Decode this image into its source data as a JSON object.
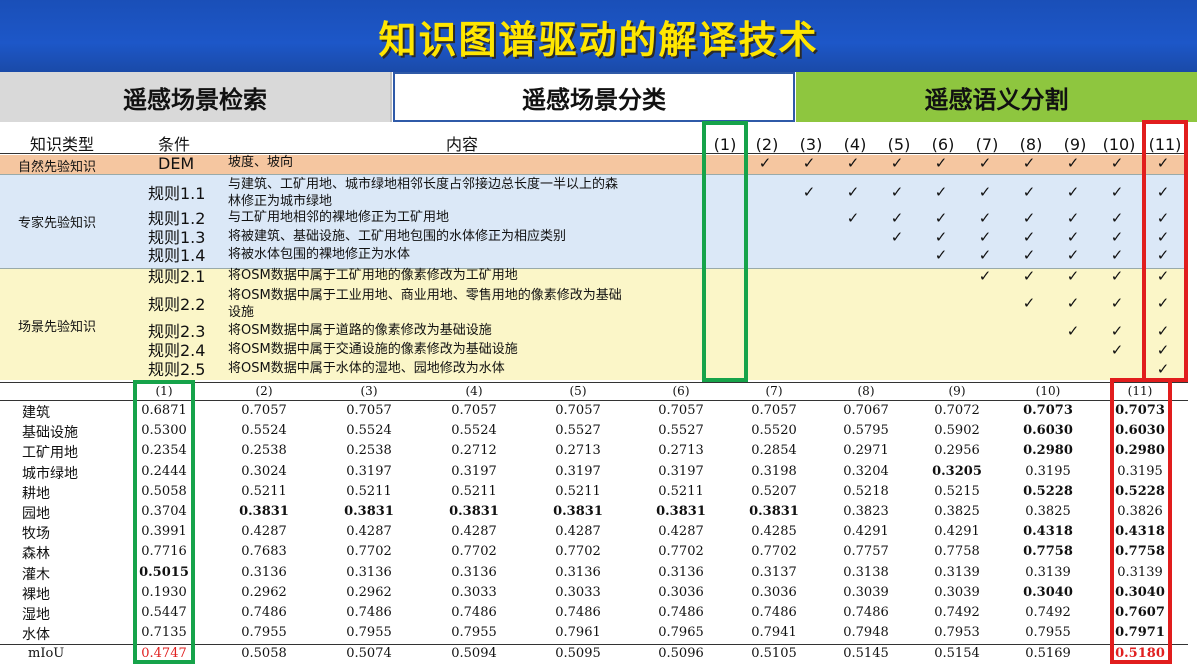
{
  "banner": {
    "title": "知识图谱驱动的解译技术"
  },
  "tabs": [
    {
      "label": "遥感场景检索"
    },
    {
      "label": "遥感场景分类"
    },
    {
      "label": "遥感语义分割"
    }
  ],
  "rules": {
    "headers": {
      "type": "知识类型",
      "cond": "条件",
      "content": "内容"
    },
    "method_cols": [
      "(1)",
      "(2)",
      "(3)",
      "(4)",
      "(5)",
      "(6)",
      "(7)",
      "(8)",
      "(9)",
      "(10)",
      "(11)"
    ],
    "check_glyph": "✓",
    "categories": {
      "natural": "自然先验知识",
      "expert": "专家先验知识",
      "scene": "场景先验知识"
    },
    "rows": [
      {
        "cond": "DEM",
        "content": [
          "坡度、坡向"
        ],
        "checks": [
          false,
          true,
          true,
          true,
          true,
          true,
          true,
          true,
          true,
          true,
          true
        ]
      },
      {
        "cond": "规则1.1",
        "content": [
          "与建筑、工矿用地、城市绿地相邻长度占邻接边总长度一半以上的森",
          "林修正为城市绿地"
        ],
        "checks": [
          false,
          false,
          true,
          true,
          true,
          true,
          true,
          true,
          true,
          true,
          true
        ]
      },
      {
        "cond": "规则1.2",
        "content": [
          "与工矿用地相邻的裸地修正为工矿用地"
        ],
        "checks": [
          false,
          false,
          false,
          true,
          true,
          true,
          true,
          true,
          true,
          true,
          true
        ]
      },
      {
        "cond": "规则1.3",
        "content": [
          "将被建筑、基础设施、工矿用地包围的水体修正为相应类别"
        ],
        "checks": [
          false,
          false,
          false,
          false,
          true,
          true,
          true,
          true,
          true,
          true,
          true
        ]
      },
      {
        "cond": "规则1.4",
        "content": [
          "将被水体包围的裸地修正为水体"
        ],
        "checks": [
          false,
          false,
          false,
          false,
          false,
          true,
          true,
          true,
          true,
          true,
          true
        ]
      },
      {
        "cond": "规则2.1",
        "content": [
          "将OSM数据中属于工矿用地的像素修改为工矿用地"
        ],
        "checks": [
          false,
          false,
          false,
          false,
          false,
          false,
          true,
          true,
          true,
          true,
          true
        ]
      },
      {
        "cond": "规则2.2",
        "content": [
          "将OSM数据中属于工业用地、商业用地、零售用地的像素修改为基础",
          "设施"
        ],
        "checks": [
          false,
          false,
          false,
          false,
          false,
          false,
          false,
          true,
          true,
          true,
          true
        ]
      },
      {
        "cond": "规则2.3",
        "content": [
          "将OSM数据中属于道路的像素修改为基础设施"
        ],
        "checks": [
          false,
          false,
          false,
          false,
          false,
          false,
          false,
          false,
          true,
          true,
          true
        ]
      },
      {
        "cond": "规则2.4",
        "content": [
          "将OSM数据中属于交通设施的像素修改为基础设施"
        ],
        "checks": [
          false,
          false,
          false,
          false,
          false,
          false,
          false,
          false,
          false,
          true,
          true
        ]
      },
      {
        "cond": "规则2.5",
        "content": [
          "将OSM数据中属于水体的湿地、园地修改为水体"
        ],
        "checks": [
          false,
          false,
          false,
          false,
          false,
          false,
          false,
          false,
          false,
          false,
          true
        ]
      }
    ]
  },
  "results": {
    "columns": [
      "(1)",
      "(2)",
      "(3)",
      "(4)",
      "(5)",
      "(6)",
      "(7)",
      "(8)",
      "(9)",
      "(10)",
      "(11)"
    ],
    "rows": [
      {
        "label": "建筑",
        "values": [
          "0.6871",
          "0.7057",
          "0.7057",
          "0.7057",
          "0.7057",
          "0.7057",
          "0.7057",
          "0.7067",
          "0.7072",
          "0.7073",
          "0.7073"
        ],
        "bold": [
          9,
          10
        ]
      },
      {
        "label": "基础设施",
        "values": [
          "0.5300",
          "0.5524",
          "0.5524",
          "0.5524",
          "0.5527",
          "0.5527",
          "0.5520",
          "0.5795",
          "0.5902",
          "0.6030",
          "0.6030"
        ],
        "bold": [
          9,
          10
        ]
      },
      {
        "label": "工矿用地",
        "values": [
          "0.2354",
          "0.2538",
          "0.2538",
          "0.2712",
          "0.2713",
          "0.2713",
          "0.2854",
          "0.2971",
          "0.2956",
          "0.2980",
          "0.2980"
        ],
        "bold": [
          9,
          10
        ]
      },
      {
        "label": "城市绿地",
        "values": [
          "0.2444",
          "0.3024",
          "0.3197",
          "0.3197",
          "0.3197",
          "0.3197",
          "0.3198",
          "0.3204",
          "0.3205",
          "0.3195",
          "0.3195"
        ],
        "bold": [
          8
        ]
      },
      {
        "label": "耕地",
        "values": [
          "0.5058",
          "0.5211",
          "0.5211",
          "0.5211",
          "0.5211",
          "0.5211",
          "0.5207",
          "0.5218",
          "0.5215",
          "0.5228",
          "0.5228"
        ],
        "bold": [
          9,
          10
        ]
      },
      {
        "label": "园地",
        "values": [
          "0.3704",
          "0.3831",
          "0.3831",
          "0.3831",
          "0.3831",
          "0.3831",
          "0.3831",
          "0.3823",
          "0.3825",
          "0.3825",
          "0.3826"
        ],
        "bold": [
          1,
          2,
          3,
          4,
          5,
          6
        ]
      },
      {
        "label": "牧场",
        "values": [
          "0.3991",
          "0.4287",
          "0.4287",
          "0.4287",
          "0.4287",
          "0.4287",
          "0.4285",
          "0.4291",
          "0.4291",
          "0.4318",
          "0.4318"
        ],
        "bold": [
          9,
          10
        ]
      },
      {
        "label": "森林",
        "values": [
          "0.7716",
          "0.7683",
          "0.7702",
          "0.7702",
          "0.7702",
          "0.7702",
          "0.7702",
          "0.7757",
          "0.7758",
          "0.7758",
          "0.7758"
        ],
        "bold": [
          9,
          10
        ]
      },
      {
        "label": "灌木",
        "values": [
          "0.5015",
          "0.3136",
          "0.3136",
          "0.3136",
          "0.3136",
          "0.3136",
          "0.3137",
          "0.3138",
          "0.3139",
          "0.3139",
          "0.3139"
        ],
        "bold": [
          0
        ]
      },
      {
        "label": "裸地",
        "values": [
          "0.1930",
          "0.2962",
          "0.2962",
          "0.3033",
          "0.3033",
          "0.3036",
          "0.3036",
          "0.3039",
          "0.3039",
          "0.3040",
          "0.3040"
        ],
        "bold": [
          9,
          10
        ]
      },
      {
        "label": "湿地",
        "values": [
          "0.5447",
          "0.7486",
          "0.7486",
          "0.7486",
          "0.7486",
          "0.7486",
          "0.7486",
          "0.7486",
          "0.7492",
          "0.7492",
          "0.7607"
        ],
        "bold": [
          10
        ]
      },
      {
        "label": "水体",
        "values": [
          "0.7135",
          "0.7955",
          "0.7955",
          "0.7955",
          "0.7961",
          "0.7965",
          "0.7941",
          "0.7948",
          "0.7953",
          "0.7955",
          "0.7971"
        ],
        "bold": [
          10
        ]
      }
    ],
    "miou": {
      "label": "mIoU",
      "values": [
        "0.4747",
        "0.5058",
        "0.5074",
        "0.5094",
        "0.5095",
        "0.5096",
        "0.5105",
        "0.5145",
        "0.5154",
        "0.5169",
        "0.5180"
      ],
      "red": [
        0,
        10
      ],
      "bold": [
        10
      ]
    }
  },
  "colors": {
    "green_highlight": "#16a34a",
    "red_highlight": "#e11d1d",
    "tab_active": "#8ec63f"
  }
}
